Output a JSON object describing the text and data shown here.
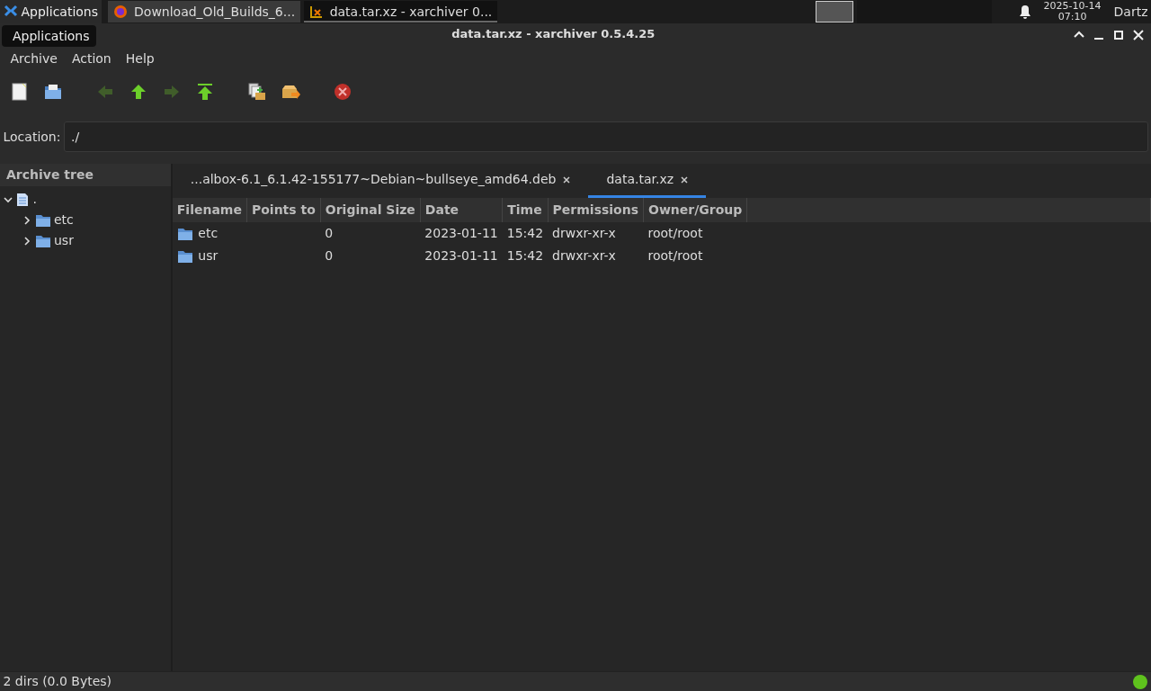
{
  "panel": {
    "apps_label": "Applications",
    "tasks": [
      {
        "title": "Download_Old_Builds_6...",
        "kind": "browser",
        "selected": false
      },
      {
        "title": "data.tar.xz - xarchiver 0...",
        "kind": "archiver",
        "selected": true
      }
    ],
    "workspaces": [
      {
        "selected": true
      },
      {
        "selected": false
      },
      {
        "selected": false
      },
      {
        "selected": false
      }
    ],
    "date": "2025-10-14",
    "time": "07:10",
    "user": "Dartz"
  },
  "tooltip": "Applications",
  "window": {
    "title": "data.tar.xz - xarchiver 0.5.4.25"
  },
  "menu": [
    "Archive",
    "Action",
    "Help"
  ],
  "toolbar": [
    {
      "kind": "new",
      "disabled": false
    },
    {
      "kind": "open",
      "disabled": false
    },
    {
      "kind": "sep"
    },
    {
      "kind": "back",
      "disabled": true
    },
    {
      "kind": "up",
      "disabled": false
    },
    {
      "kind": "forward",
      "disabled": true
    },
    {
      "kind": "top",
      "disabled": false
    },
    {
      "kind": "sep"
    },
    {
      "kind": "add",
      "disabled": false
    },
    {
      "kind": "extract",
      "disabled": false
    },
    {
      "kind": "sep"
    },
    {
      "kind": "stop",
      "disabled": false
    }
  ],
  "location": {
    "label": "Location:",
    "value": "./"
  },
  "sidebar": {
    "title": "Archive tree",
    "root": {
      "label": ".",
      "expanded": true,
      "children": [
        {
          "label": "etc",
          "expanded": false
        },
        {
          "label": "usr",
          "expanded": false
        }
      ]
    }
  },
  "tabs": [
    {
      "label": "...albox-6.1_6.1.42-155177~Debian~bullseye_amd64.deb",
      "selected": false
    },
    {
      "label": "data.tar.xz",
      "selected": true
    }
  ],
  "table": {
    "columns": [
      "Filename",
      "Points to",
      "Original Size",
      "Date",
      "Time",
      "Permissions",
      "Owner/Group"
    ],
    "rows": [
      [
        "etc",
        "",
        "0",
        "2023-01-11",
        "15:42",
        "drwxr-xr-x",
        "root/root"
      ],
      [
        "usr",
        "",
        "0",
        "2023-01-11",
        "15:42",
        "drwxr-xr-x",
        "root/root"
      ]
    ]
  },
  "status_bar": "2 dirs  (0.0 Bytes)"
}
